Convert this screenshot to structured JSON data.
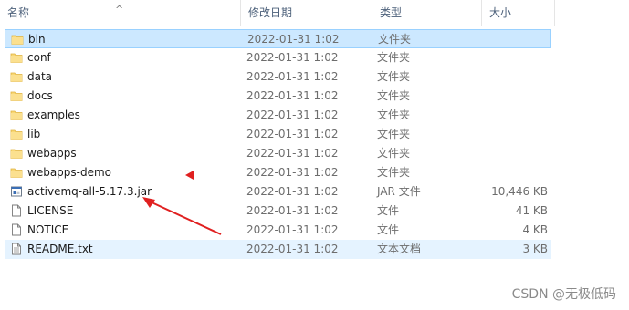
{
  "columns": {
    "name": "名称",
    "date": "修改日期",
    "type": "类型",
    "size": "大小"
  },
  "files": [
    {
      "name": "bin",
      "date": "2022-01-31 1:02",
      "type": "文件夹",
      "size": "",
      "icon": "folder-icon"
    },
    {
      "name": "conf",
      "date": "2022-01-31 1:02",
      "type": "文件夹",
      "size": "",
      "icon": "folder-icon"
    },
    {
      "name": "data",
      "date": "2022-01-31 1:02",
      "type": "文件夹",
      "size": "",
      "icon": "folder-icon"
    },
    {
      "name": "docs",
      "date": "2022-01-31 1:02",
      "type": "文件夹",
      "size": "",
      "icon": "folder-icon"
    },
    {
      "name": "examples",
      "date": "2022-01-31 1:02",
      "type": "文件夹",
      "size": "",
      "icon": "folder-icon"
    },
    {
      "name": "lib",
      "date": "2022-01-31 1:02",
      "type": "文件夹",
      "size": "",
      "icon": "folder-icon"
    },
    {
      "name": "webapps",
      "date": "2022-01-31 1:02",
      "type": "文件夹",
      "size": "",
      "icon": "folder-icon"
    },
    {
      "name": "webapps-demo",
      "date": "2022-01-31 1:02",
      "type": "文件夹",
      "size": "",
      "icon": "folder-icon"
    },
    {
      "name": "activemq-all-5.17.3.jar",
      "date": "2022-01-31 1:02",
      "type": "JAR 文件",
      "size": "10,446 KB",
      "icon": "jar-file-icon"
    },
    {
      "name": "LICENSE",
      "date": "2022-01-31 1:02",
      "type": "文件",
      "size": "41 KB",
      "icon": "file-icon"
    },
    {
      "name": "NOTICE",
      "date": "2022-01-31 1:02",
      "type": "文件",
      "size": "4 KB",
      "icon": "file-icon"
    },
    {
      "name": "README.txt",
      "date": "2022-01-31 1:02",
      "type": "文本文档",
      "size": "3 KB",
      "icon": "text-file-icon"
    }
  ],
  "colors": {
    "selected_bg": "#cce8ff",
    "hover_bg": "#e5f3ff",
    "annotation": "#e02020",
    "folder": "#f8d775"
  },
  "watermark": "CSDN @无极低码"
}
